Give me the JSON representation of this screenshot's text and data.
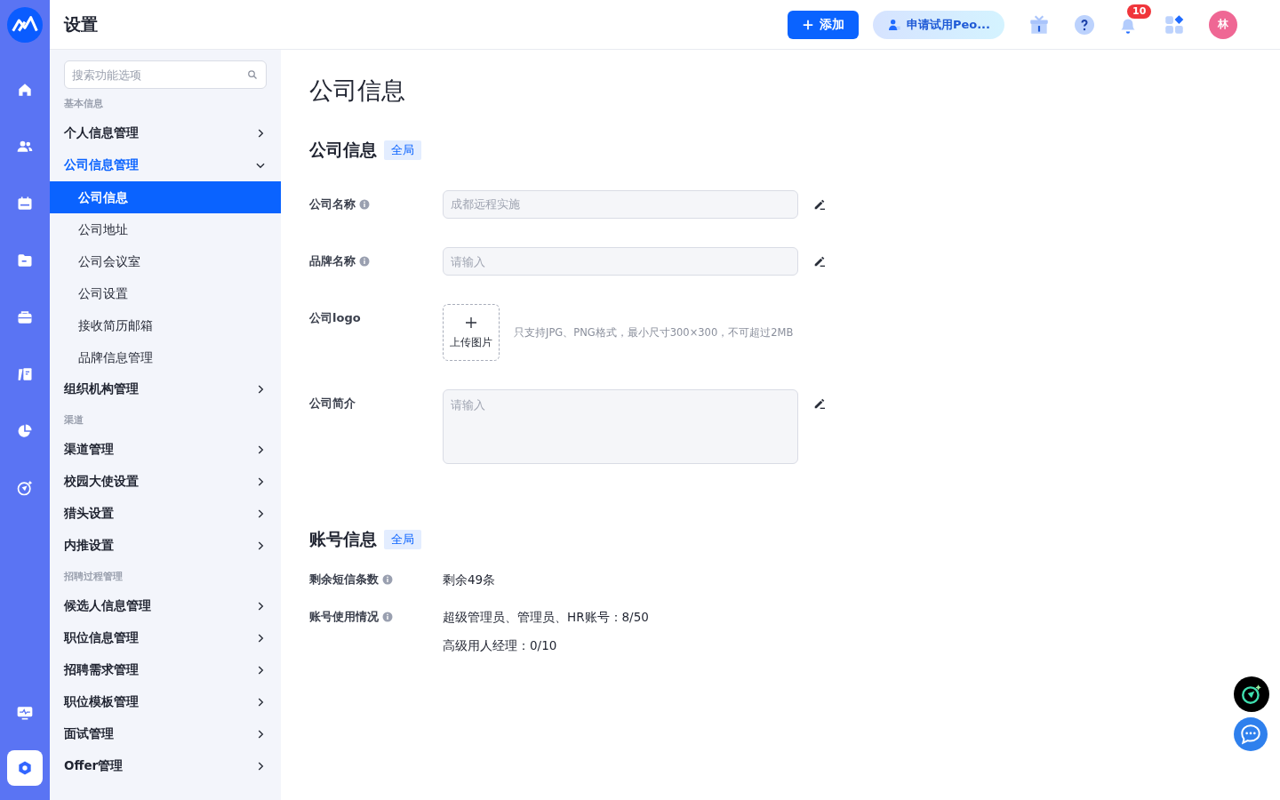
{
  "rail": {
    "items": [
      {
        "kind": "home",
        "selected": false
      },
      {
        "kind": "people",
        "selected": false
      },
      {
        "kind": "calendar",
        "selected": false
      },
      {
        "kind": "folder",
        "selected": false
      },
      {
        "kind": "briefcase",
        "selected": false
      },
      {
        "kind": "book",
        "selected": false
      },
      {
        "kind": "pie",
        "selected": false
      },
      {
        "kind": "target",
        "selected": false
      }
    ],
    "bottom": [
      {
        "kind": "monitor",
        "selected": false
      },
      {
        "kind": "settings",
        "selected": true
      }
    ]
  },
  "header": {
    "title": "设置",
    "add_button": "添加",
    "trial_button": "申请试用Peo...",
    "notification_count": "10",
    "avatar": "林"
  },
  "sidebar": {
    "search": {
      "placeholder": "搜索功能选项"
    },
    "groups": [
      {
        "heading": "基本信息",
        "items": [
          {
            "label": "个人信息管理",
            "expanded": false
          },
          {
            "label": "公司信息管理",
            "expanded": true,
            "children": [
              {
                "label": "公司信息",
                "selected": true
              },
              {
                "label": "公司地址",
                "selected": false
              },
              {
                "label": "公司会议室",
                "selected": false
              },
              {
                "label": "公司设置",
                "selected": false
              },
              {
                "label": "接收简历邮箱",
                "selected": false
              },
              {
                "label": "品牌信息管理",
                "selected": false
              }
            ]
          },
          {
            "label": "组织机构管理",
            "expanded": false
          }
        ]
      },
      {
        "heading": "渠道",
        "items": [
          {
            "label": "渠道管理",
            "expanded": false
          },
          {
            "label": "校园大使设置",
            "expanded": false
          },
          {
            "label": "猎头设置",
            "expanded": false
          },
          {
            "label": "内推设置",
            "expanded": false
          }
        ]
      },
      {
        "heading": "招聘过程管理",
        "items": [
          {
            "label": "候选人信息管理",
            "expanded": false
          },
          {
            "label": "职位信息管理",
            "expanded": false
          },
          {
            "label": "招聘需求管理",
            "expanded": false
          },
          {
            "label": "职位模板管理",
            "expanded": false
          },
          {
            "label": "面试管理",
            "expanded": false
          },
          {
            "label": "Offer管理",
            "expanded": false
          }
        ]
      }
    ]
  },
  "main": {
    "title": "公司信息",
    "sections": [
      {
        "title": "公司信息",
        "tag": "全局",
        "fields": [
          {
            "kind": "input",
            "label": "公司名称",
            "info": true,
            "value": "成都远程实施",
            "disabled": true
          },
          {
            "kind": "input",
            "label": "品牌名称",
            "info": true,
            "placeholder": "请输入",
            "disabled": true
          },
          {
            "kind": "upload",
            "label": "公司logo",
            "info": false,
            "button": "上传图片",
            "hint": "只支持JPG、PNG格式，最小尺寸300×300，不可超过2MB"
          },
          {
            "kind": "textarea",
            "label": "公司简介",
            "info": false,
            "placeholder": "请输入",
            "disabled": true
          }
        ]
      },
      {
        "title": "账号信息",
        "tag": "全局",
        "fields": [
          {
            "kind": "text",
            "label": "剩余短信条数",
            "info": true,
            "lines": [
              "剩余49条"
            ]
          },
          {
            "kind": "text",
            "label": "账号使用情况",
            "info": true,
            "lines": [
              "超级管理员、管理员、HR账号：8/50",
              "高级用人经理：0/10"
            ]
          }
        ]
      }
    ]
  }
}
